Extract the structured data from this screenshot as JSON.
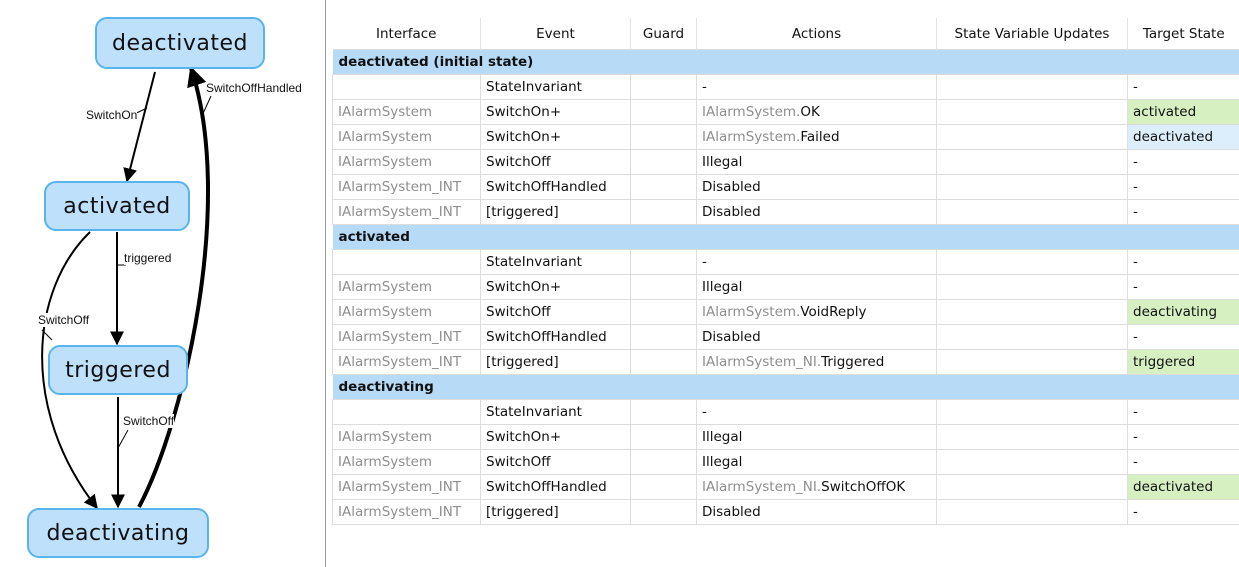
{
  "diagram": {
    "states": {
      "deactivated": "deactivated",
      "activated": "activated",
      "triggered": "triggered",
      "deactivating": "deactivating"
    },
    "edges": {
      "switch_on": "SwitchOn",
      "switch_off_handled": "SwitchOffHandled",
      "triggered": "triggered",
      "switch_off_left": "SwitchOff",
      "switch_off_center": "SwitchOff"
    },
    "colors": {
      "node_fill": "#bfe0fb",
      "node_border": "#58b4ec"
    }
  },
  "table": {
    "headers": {
      "interface": "Interface",
      "event": "Event",
      "guard": "Guard",
      "actions": "Actions",
      "state_variable_updates": "State Variable Updates",
      "target_state": "Target State"
    },
    "groups": [
      {
        "title": "deactivated (initial state)",
        "rows": [
          {
            "interface": "",
            "event": "StateInvariant",
            "guard": "",
            "action_iface": "",
            "action_name": "-",
            "svu": "",
            "target": "-",
            "target_color": "none"
          },
          {
            "interface": "IAlarmSystem",
            "event": "SwitchOn+",
            "guard": "",
            "action_iface": "IAlarmSystem.",
            "action_name": "OK",
            "svu": "",
            "target": "activated",
            "target_color": "green"
          },
          {
            "interface": "IAlarmSystem",
            "event": "SwitchOn+",
            "guard": "",
            "action_iface": "IAlarmSystem.",
            "action_name": "Failed",
            "svu": "",
            "target": "deactivated",
            "target_color": "blue"
          },
          {
            "interface": "IAlarmSystem",
            "event": "SwitchOff",
            "guard": "",
            "action_iface": "",
            "action_name": "Illegal",
            "svu": "",
            "target": "-",
            "target_color": "none"
          },
          {
            "interface": "IAlarmSystem_INT",
            "event": "SwitchOffHandled",
            "guard": "",
            "action_iface": "",
            "action_name": "Disabled",
            "svu": "",
            "target": "-",
            "target_color": "none"
          },
          {
            "interface": "IAlarmSystem_INT",
            "event": "[triggered]",
            "guard": "",
            "action_iface": "",
            "action_name": "Disabled",
            "svu": "",
            "target": "-",
            "target_color": "none"
          }
        ]
      },
      {
        "title": "activated",
        "rows": [
          {
            "interface": "",
            "event": "StateInvariant",
            "guard": "",
            "action_iface": "",
            "action_name": "-",
            "svu": "",
            "target": "-",
            "target_color": "none"
          },
          {
            "interface": "IAlarmSystem",
            "event": "SwitchOn+",
            "guard": "",
            "action_iface": "",
            "action_name": "Illegal",
            "svu": "",
            "target": "-",
            "target_color": "none"
          },
          {
            "interface": "IAlarmSystem",
            "event": "SwitchOff",
            "guard": "",
            "action_iface": "IAlarmSystem.",
            "action_name": "VoidReply",
            "svu": "",
            "target": "deactivating",
            "target_color": "green"
          },
          {
            "interface": "IAlarmSystem_INT",
            "event": "SwitchOffHandled",
            "guard": "",
            "action_iface": "",
            "action_name": "Disabled",
            "svu": "",
            "target": "-",
            "target_color": "none"
          },
          {
            "interface": "IAlarmSystem_INT",
            "event": "[triggered]",
            "guard": "",
            "action_iface": "IAlarmSystem_NI.",
            "action_name": "Triggered",
            "svu": "",
            "target": "triggered",
            "target_color": "green"
          }
        ]
      },
      {
        "title": "deactivating",
        "rows": [
          {
            "interface": "",
            "event": "StateInvariant",
            "guard": "",
            "action_iface": "",
            "action_name": "-",
            "svu": "",
            "target": "-",
            "target_color": "none"
          },
          {
            "interface": "IAlarmSystem",
            "event": "SwitchOn+",
            "guard": "",
            "action_iface": "",
            "action_name": "Illegal",
            "svu": "",
            "target": "-",
            "target_color": "none"
          },
          {
            "interface": "IAlarmSystem",
            "event": "SwitchOff",
            "guard": "",
            "action_iface": "",
            "action_name": "Illegal",
            "svu": "",
            "target": "-",
            "target_color": "none"
          },
          {
            "interface": "IAlarmSystem_INT",
            "event": "SwitchOffHandled",
            "guard": "",
            "action_iface": "IAlarmSystem_NI.",
            "action_name": "SwitchOffOK",
            "svu": "",
            "target": "deactivated",
            "target_color": "green"
          },
          {
            "interface": "IAlarmSystem_INT",
            "event": "[triggered]",
            "guard": "",
            "action_iface": "",
            "action_name": "Disabled",
            "svu": "",
            "target": "-",
            "target_color": "none"
          }
        ]
      }
    ],
    "colors": {
      "group_header": "#b7daf7",
      "target_green": "#d6f0c2",
      "target_blue": "#dcedfb",
      "interface_text": "#8e8e8e"
    }
  }
}
